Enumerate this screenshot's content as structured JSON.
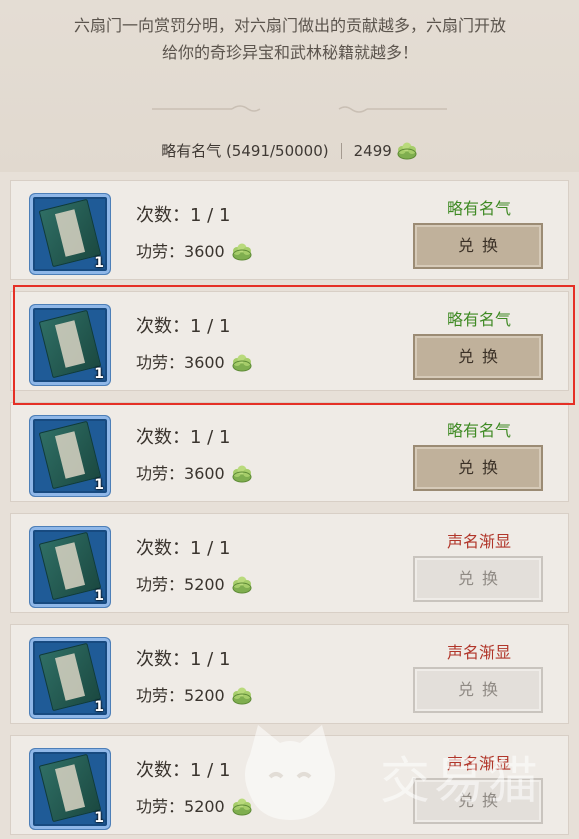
{
  "intro": {
    "line1": "六扇门一向赏罚分明，对六扇门做出的贡献越多，六扇门开放",
    "line2": "给你的奇珍异宝和武林秘籍就越多！"
  },
  "status": {
    "reputation": "略有名气 (5491/50000)",
    "points": "2499"
  },
  "items": [
    {
      "count": "次数：1 / 1",
      "merit_label": "功劳：",
      "merit": "3600",
      "rank": "略有名气",
      "rank_color": "#3f8a24",
      "button": "兑换",
      "enabled": true,
      "qty": "1"
    },
    {
      "count": "次数：1 / 1",
      "merit_label": "功劳：",
      "merit": "3600",
      "rank": "略有名气",
      "rank_color": "#3f8a24",
      "button": "兑换",
      "enabled": true,
      "qty": "1"
    },
    {
      "count": "次数：1 / 1",
      "merit_label": "功劳：",
      "merit": "3600",
      "rank": "略有名气",
      "rank_color": "#3f8a24",
      "button": "兑换",
      "enabled": true,
      "qty": "1"
    },
    {
      "count": "次数：1 / 1",
      "merit_label": "功劳：",
      "merit": "5200",
      "rank": "声名渐显",
      "rank_color": "#b1362a",
      "button": "兑换",
      "enabled": false,
      "qty": "1"
    },
    {
      "count": "次数：1 / 1",
      "merit_label": "功劳：",
      "merit": "5200",
      "rank": "声名渐显",
      "rank_color": "#b1362a",
      "button": "兑换",
      "enabled": false,
      "qty": "1"
    },
    {
      "count": "次数：1 / 1",
      "merit_label": "功劳：",
      "merit": "5200",
      "rank": "声名渐显",
      "rank_color": "#b1362a",
      "button": "兑换",
      "enabled": false,
      "qty": "1"
    }
  ],
  "watermark": {
    "text": "交易猫"
  }
}
